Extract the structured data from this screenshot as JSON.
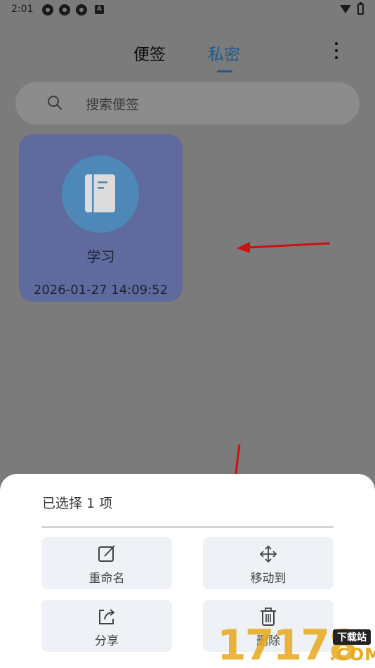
{
  "status_bar": {
    "time": "2:01",
    "notif_icons": [
      "app-icon",
      "app-icon",
      "app-icon"
    ],
    "letter_badge": "A"
  },
  "tabs": [
    {
      "label": "便签",
      "selected": false
    },
    {
      "label": "私密",
      "selected": true
    }
  ],
  "search": {
    "placeholder": "搜索便签"
  },
  "note": {
    "title": "学习",
    "date": "2026-01-27 14:09:52",
    "icon": "notebook-icon"
  },
  "sheet": {
    "title": "已选择 1 项",
    "actions": [
      {
        "label": "重命名",
        "icon": "edit-icon"
      },
      {
        "label": "移动到",
        "icon": "move-icon"
      },
      {
        "label": "分享",
        "icon": "share-icon"
      },
      {
        "label": "删除",
        "icon": "trash-icon"
      }
    ]
  },
  "watermark": {
    "digits": "17178",
    "badge": "下载站",
    "domain": ".COM"
  },
  "colors": {
    "accent": "#1f5a8e",
    "card": "#5f6a9e",
    "circle": "#4d88b8",
    "arrow": "#d01010",
    "watermark": "#e8a91e"
  }
}
